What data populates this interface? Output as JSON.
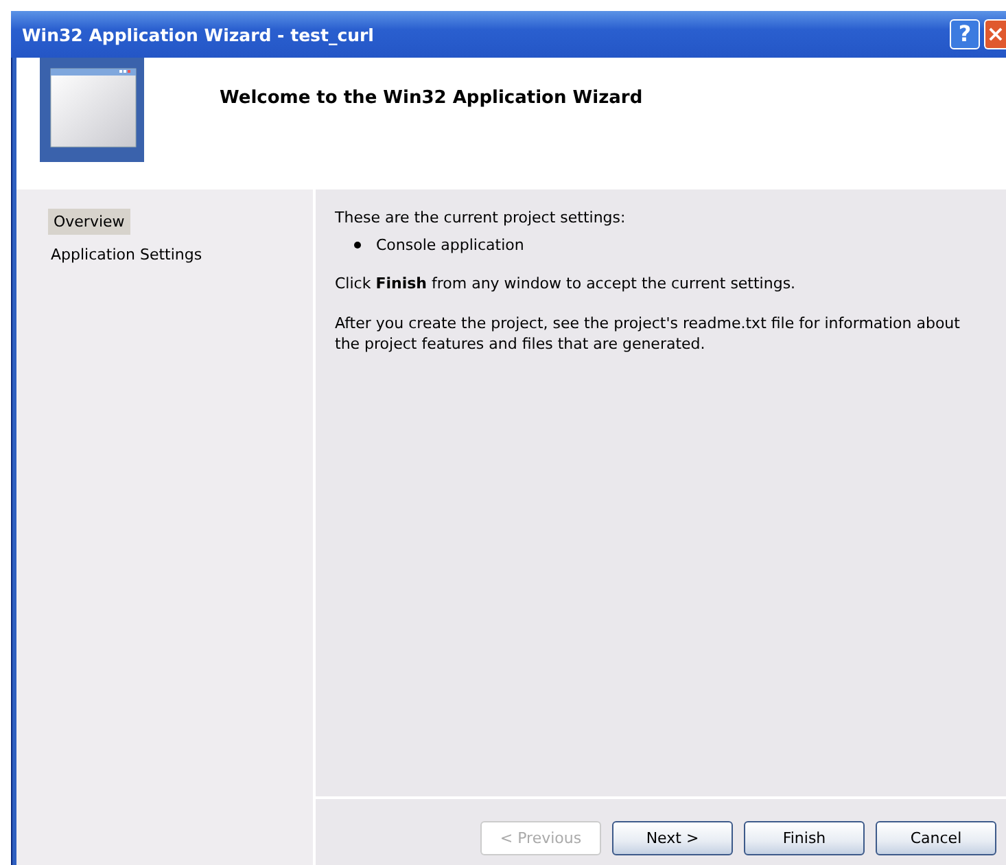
{
  "window": {
    "title": "Win32 Application Wizard - test_curl"
  },
  "title_buttons": [
    {
      "kind": "help",
      "label": "?"
    },
    {
      "kind": "close",
      "label": "×"
    }
  ],
  "header": {
    "title": "Welcome to the Win32 Application Wizard"
  },
  "sidebar": {
    "items": [
      {
        "label": "Overview",
        "selected": true
      },
      {
        "label": "Application Settings",
        "selected": false
      }
    ]
  },
  "content": {
    "intro": "These are the current project settings:",
    "bullets": [
      "Console application"
    ],
    "paragraphs": [
      "Click **Finish** from any window to accept the current settings.",
      "After you create the project, see the project's readme.txt file for information about the project features and files that are generated."
    ]
  },
  "buttons": [
    {
      "label": "< Previous",
      "disabled": true
    },
    {
      "label": "Next >",
      "disabled": false
    },
    {
      "label": "Finish",
      "disabled": false
    },
    {
      "label": "Cancel",
      "disabled": false
    }
  ]
}
